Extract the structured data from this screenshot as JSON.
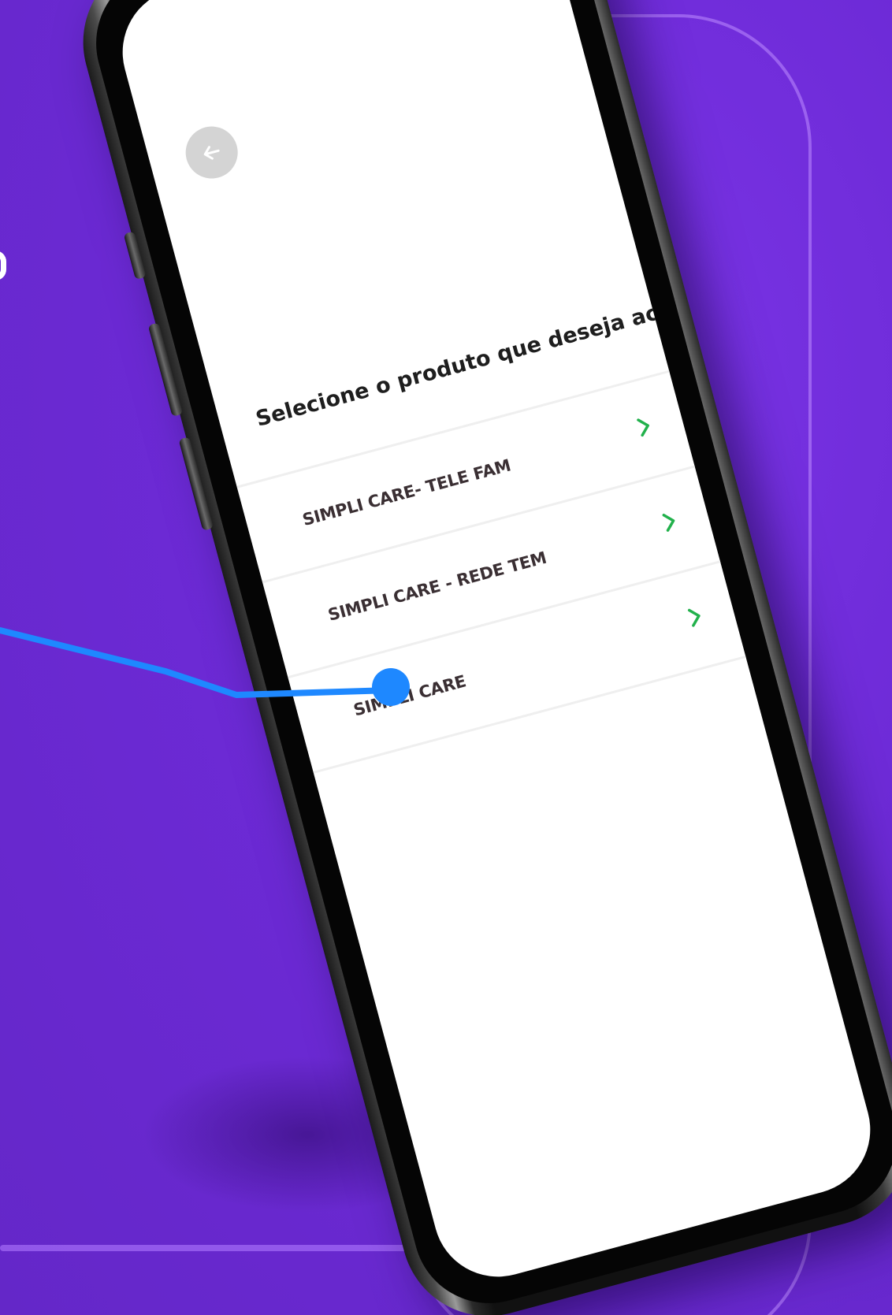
{
  "screen": {
    "title": "Selecione o produto que deseja acessar",
    "back_icon": "arrow-left-icon",
    "items": [
      {
        "label": "SIMPLI CARE- TELE FAM",
        "icon": "chevron-right-icon"
      },
      {
        "label": "SIMPLI CARE - REDE TEM",
        "icon": "chevron-right-icon"
      },
      {
        "label": "SIMPLI CARE",
        "icon": "chevron-right-icon"
      }
    ]
  },
  "colors": {
    "background": "#6f2bd9",
    "chevron": "#22b14c",
    "annotation": "#1e88ff",
    "back_button": "#d4d4d4"
  }
}
